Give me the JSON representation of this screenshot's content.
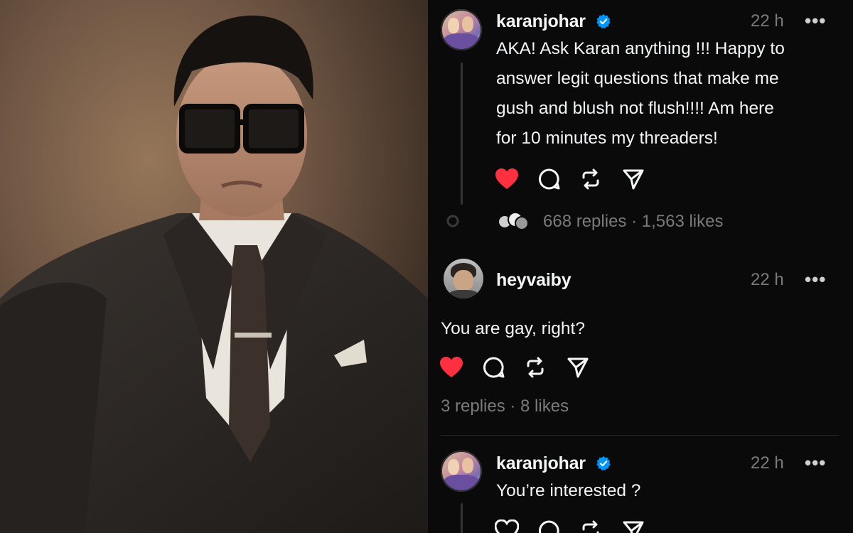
{
  "thread": {
    "post1": {
      "username": "karanjohar",
      "verified": true,
      "time": "22 h",
      "more_label": "•••",
      "lines": [
        "AKA! Ask Karan anything !!! Happy to",
        "answer legit questions that make me",
        "gush and blush not flush!!!! Am here",
        "for 10 minutes my threaders!"
      ],
      "liked": true,
      "stats": "668 replies · 1,563 likes"
    },
    "post2": {
      "username": "heyvaiby",
      "time": "22 h",
      "more_label": "•••",
      "text": "You are gay, right?",
      "liked": true,
      "stats": "3 replies · 8 likes"
    },
    "post3": {
      "username": "karanjohar",
      "verified": true,
      "time": "22 h",
      "more_label": "•••",
      "text": "You’re interested ?"
    }
  },
  "icons": {
    "like": "heart-icon",
    "reply": "comment-icon",
    "repost": "repost-icon",
    "share": "send-icon",
    "verified": "verified-badge-icon"
  },
  "colors": {
    "like_red": "#ff3040",
    "verified_blue": "#0095f6",
    "muted_text": "#7a7a7a",
    "background": "#0a0a0a"
  }
}
